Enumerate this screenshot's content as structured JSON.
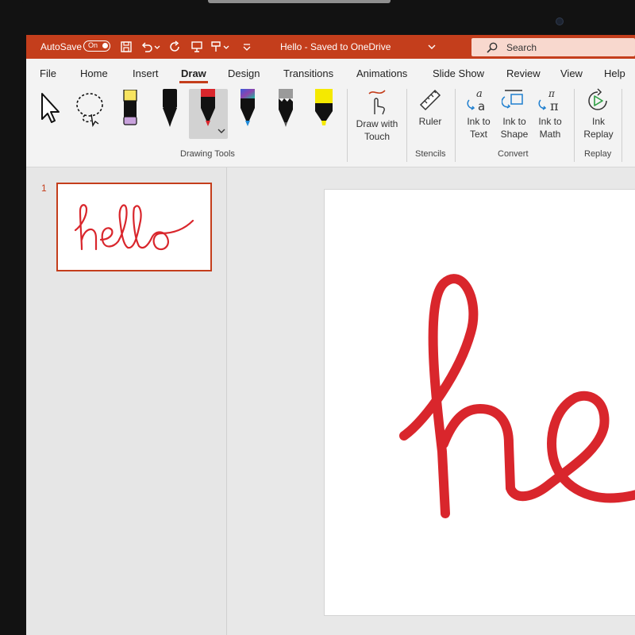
{
  "titlebar": {
    "autosave_label": "AutoSave",
    "autosave_state": "On",
    "doc_title": "Hello - Saved to OneDrive",
    "search_placeholder": "Search",
    "accent_color": "#c43e1c"
  },
  "tabs": [
    {
      "label": "File"
    },
    {
      "label": "Home"
    },
    {
      "label": "Insert"
    },
    {
      "label": "Draw",
      "active": true
    },
    {
      "label": "Design"
    },
    {
      "label": "Transitions"
    },
    {
      "label": "Animations"
    },
    {
      "label": "Slide Show"
    },
    {
      "label": "Review"
    },
    {
      "label": "View"
    },
    {
      "label": "Help"
    }
  ],
  "ribbon": {
    "draw_with_touch": {
      "line1": "Draw with",
      "line2": "Touch"
    },
    "ruler": "Ruler",
    "ink_to_text": {
      "line1": "Ink to",
      "line2": "Text"
    },
    "ink_to_shape": {
      "line1": "Ink to",
      "line2": "Shape"
    },
    "ink_to_math": {
      "line1": "Ink to",
      "line2": "Math"
    },
    "ink_replay": {
      "line1": "Ink",
      "line2": "Replay"
    },
    "groups": {
      "drawing_tools": "Drawing Tools",
      "stencils": "Stencils",
      "convert": "Convert",
      "replay": "Replay"
    }
  },
  "slides": [
    {
      "number": "1",
      "ink_text": "hello",
      "ink_color": "#d9262c"
    }
  ]
}
